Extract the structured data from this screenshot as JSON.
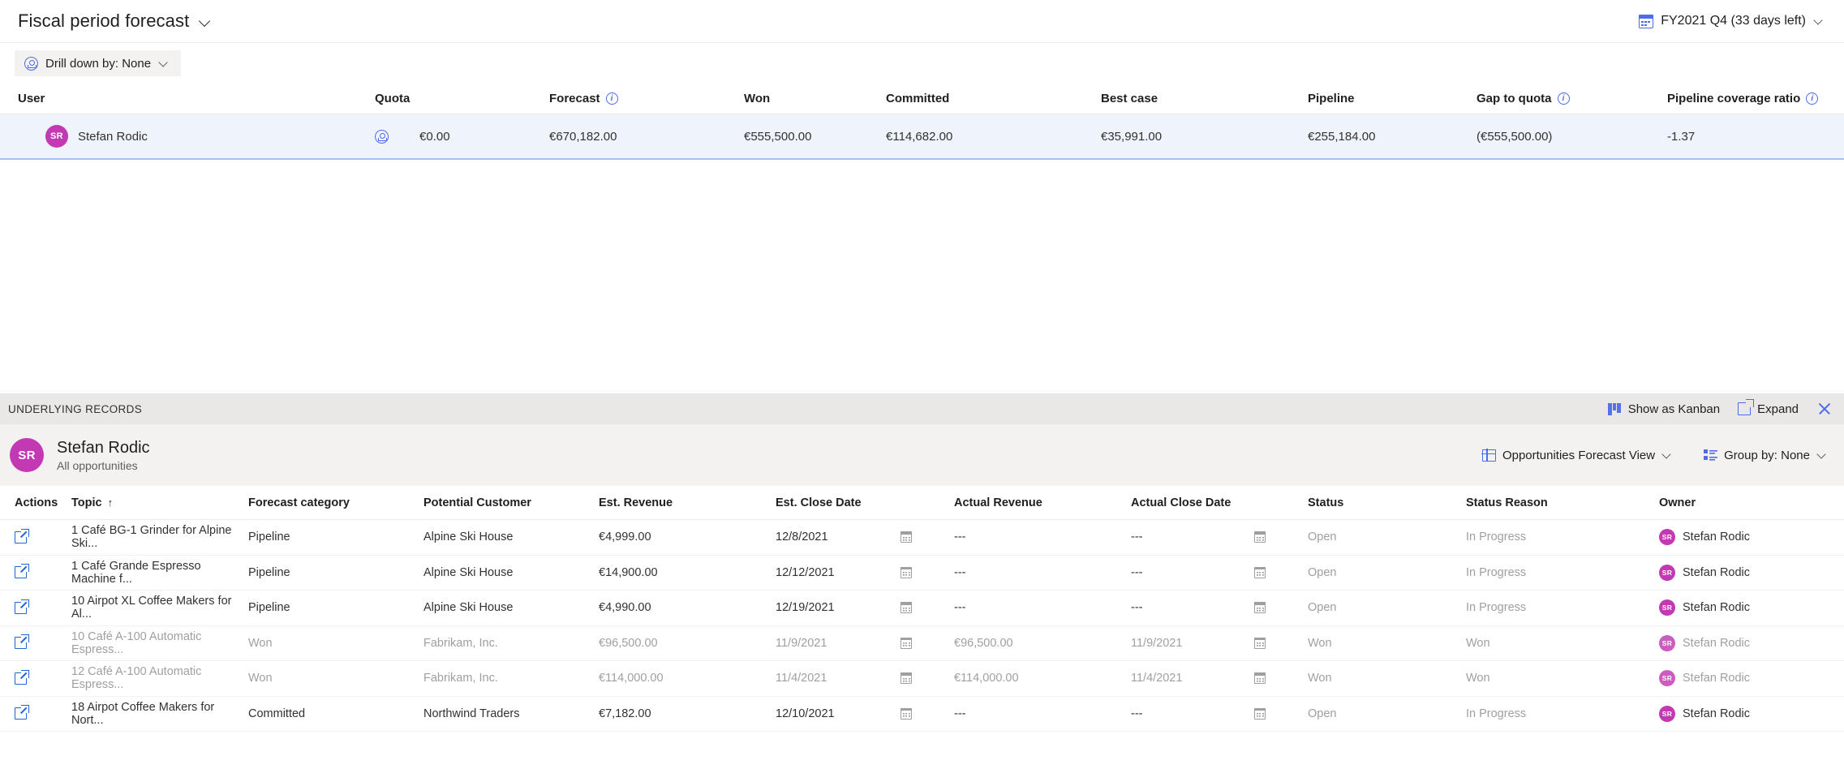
{
  "header": {
    "title": "Fiscal period forecast",
    "title_chevron_icon": "chevron-down-icon",
    "fiscal_period": "FY2021 Q4 (33 days left)",
    "calendar_icon": "calendar-icon"
  },
  "toolbar": {
    "drill_down_label": "Drill down by: None",
    "drill_down_icon": "drill-down-icon"
  },
  "forecast_table": {
    "columns": [
      {
        "label": "User",
        "info": false
      },
      {
        "label": "Quota",
        "info": false
      },
      {
        "label": "Forecast",
        "info": true
      },
      {
        "label": "Won",
        "info": false
      },
      {
        "label": "Committed",
        "info": false
      },
      {
        "label": "Best case",
        "info": false
      },
      {
        "label": "Pipeline",
        "info": false
      },
      {
        "label": "Gap to quota",
        "info": true
      },
      {
        "label": "Pipeline coverage ratio",
        "info": true
      }
    ],
    "row": {
      "avatar_initials": "SR",
      "user": "Stefan Rodic",
      "quota": "€0.00",
      "forecast": "€670,182.00",
      "won": "€555,500.00",
      "committed": "€114,682.00",
      "best_case": "€35,991.00",
      "pipeline": "€255,184.00",
      "gap_to_quota": "(€555,500.00)",
      "pipeline_coverage_ratio": "-1.37"
    }
  },
  "underlying_records": {
    "panel_title": "UNDERLYING RECORDS",
    "show_as_kanban": "Show as Kanban",
    "expand": "Expand",
    "close_icon": "close-icon",
    "kanban_icon": "kanban-icon",
    "expand_icon": "expand-icon",
    "user": {
      "avatar_initials": "SR",
      "name": "Stefan Rodic",
      "subtitle": "All opportunities"
    },
    "view_selector": "Opportunities Forecast View",
    "group_by": "Group by:  None",
    "grid_icon": "grid-icon",
    "list-icon": "list-icon",
    "columns": [
      "Actions",
      "Topic",
      "Forecast category",
      "Potential Customer",
      "Est. Revenue",
      "Est. Close Date",
      "Actual Revenue",
      "Actual Close Date",
      "Status",
      "Status Reason",
      "Owner"
    ],
    "topic_sort_indicator": "↑",
    "rows": [
      {
        "action_icon": "open-record-icon",
        "topic": "1 Café BG-1 Grinder for Alpine Ski...",
        "forecast_category": "Pipeline",
        "potential_customer": "Alpine Ski House",
        "est_revenue": "€4,999.00",
        "est_close_date": "12/8/2021",
        "actual_revenue": "---",
        "actual_close_date": "---",
        "status": "Open",
        "status_reason": "In Progress",
        "owner_initials": "SR",
        "owner": "Stefan Rodic",
        "dimmed": false
      },
      {
        "action_icon": "open-record-icon",
        "topic": "1 Café Grande Espresso Machine f...",
        "forecast_category": "Pipeline",
        "potential_customer": "Alpine Ski House",
        "est_revenue": "€14,900.00",
        "est_close_date": "12/12/2021",
        "actual_revenue": "---",
        "actual_close_date": "---",
        "status": "Open",
        "status_reason": "In Progress",
        "owner_initials": "SR",
        "owner": "Stefan Rodic",
        "dimmed": false
      },
      {
        "action_icon": "open-record-icon",
        "topic": "10 Airpot XL Coffee Makers for Al...",
        "forecast_category": "Pipeline",
        "potential_customer": "Alpine Ski House",
        "est_revenue": "€4,990.00",
        "est_close_date": "12/19/2021",
        "actual_revenue": "---",
        "actual_close_date": "---",
        "status": "Open",
        "status_reason": "In Progress",
        "owner_initials": "SR",
        "owner": "Stefan Rodic",
        "dimmed": false
      },
      {
        "action_icon": "open-record-icon",
        "topic": "10 Café A-100 Automatic Espress...",
        "forecast_category": "Won",
        "potential_customer": "Fabrikam, Inc.",
        "est_revenue": "€96,500.00",
        "est_close_date": "11/9/2021",
        "actual_revenue": "€96,500.00",
        "actual_close_date": "11/9/2021",
        "status": "Won",
        "status_reason": "Won",
        "owner_initials": "SR",
        "owner": "Stefan Rodic",
        "dimmed": true
      },
      {
        "action_icon": "open-record-icon",
        "topic": "12 Café A-100 Automatic Espress...",
        "forecast_category": "Won",
        "potential_customer": "Fabrikam, Inc.",
        "est_revenue": "€114,000.00",
        "est_close_date": "11/4/2021",
        "actual_revenue": "€114,000.00",
        "actual_close_date": "11/4/2021",
        "status": "Won",
        "status_reason": "Won",
        "owner_initials": "SR",
        "owner": "Stefan Rodic",
        "dimmed": true
      },
      {
        "action_icon": "open-record-icon",
        "topic": "18 Airpot Coffee Makers for Nort...",
        "forecast_category": "Committed",
        "potential_customer": "Northwind Traders",
        "est_revenue": "€7,182.00",
        "est_close_date": "12/10/2021",
        "actual_revenue": "---",
        "actual_close_date": "---",
        "status": "Open",
        "status_reason": "In Progress",
        "owner_initials": "SR",
        "owner": "Stefan Rodic",
        "dimmed": false
      }
    ]
  },
  "colors": {
    "avatar": "#c239b3",
    "accent": "#4f6bed",
    "row_selected_bg": "#eff3fc",
    "panel_bg": "#f3f2f1"
  }
}
